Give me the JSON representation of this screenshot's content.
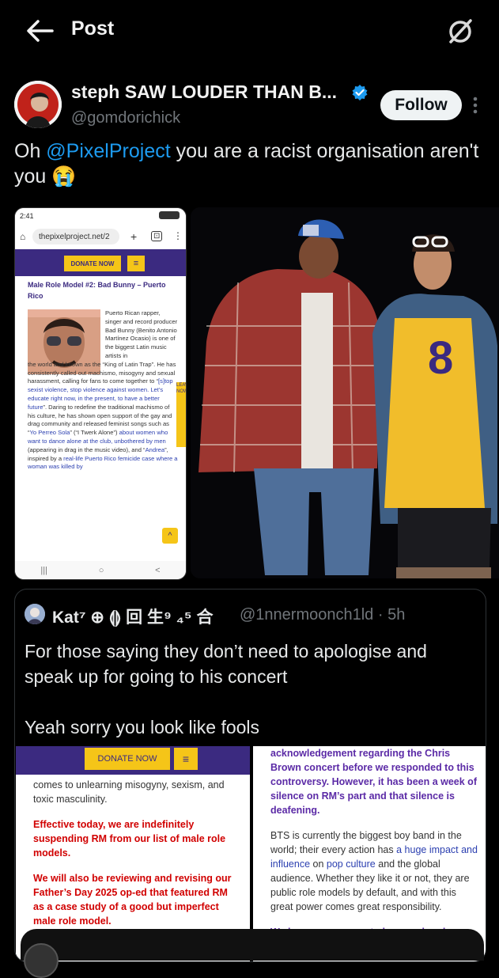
{
  "header": {
    "title": "Post"
  },
  "author": {
    "name": "steph SAW LOUDER THAN B...",
    "handle": "@gomdorichick",
    "follow_label": "Follow"
  },
  "tweet": {
    "text_before": "Oh ",
    "mention": "@PixelProject",
    "text_after": " you are a racist organisation aren't you 😭"
  },
  "media1": {
    "status_time": "2:41",
    "url": "thepixelproject.net/2",
    "donate": "DONATE NOW",
    "menu": "≡",
    "heading": "Male Role Model #2: Bad Bunny – Puerto Rico",
    "body_right": "Puerto Rican rapper, singer and record producer Bad Bunny (Benito Antonio Martínez Ocasio) is one of the biggest Latin music artists in",
    "body_full": "the world and known as the “King of Latin Trap”. He has consistently called out machismo, misogyny and sexual harassment, calling for fans to come together to “",
    "body_link1": "[s]top sexist violence, stop violence against women. Let’s educate right now, in the present, to have a better future",
    "body_mid": "”. Daring to redefine the traditional machismo of his culture, he has shown open support of the gay and drag community and released feminist songs such as “",
    "body_link2": "Yo Perreo Sola",
    "body_mid2": "” (“I Twerk Alone”) ",
    "body_link3": "about women who want to dance alone at the club, unbothered by men",
    "body_mid3": " (appearing in drag in the music video), and “",
    "body_link4": "Andrea",
    "body_mid4": "”, inspired by a ",
    "body_link5": "real-life Puerto Rico femicide case where a woman was killed by",
    "leave_now": "LEAVE NOW"
  },
  "quote": {
    "name": "Kat⁷ ⊕ ⟬⟭ 回 生⁹ ₄⁵ 合",
    "handle": "@1nnermoonch1ld · 5h",
    "text": "For those saying they don’t need to apologise and speak up for going to his concert\n\nYeah sorry you look like fools",
    "img1": {
      "donate": "DONATE NOW",
      "menu": "≡",
      "line1": "comes to unlearning misogyny, sexism, and toxic masculinity.",
      "red1": "Effective today, we are indefinitely suspending RM from our list of male role models.",
      "red2": "We will also be reviewing and revising our Father’s Day 2025 op-ed that featured RM as a case study of a good but imperfect male role model."
    },
    "img2": {
      "purple1": "acknowledgement regarding the Chris Brown concert before we responded to this controversy. However, it has been a week of silence on RM’s part and that silence is deafening.",
      "p2a": "BTS is currently the biggest boy band in the world; their every action has ",
      "link1": "a huge impact and influence",
      "p2b": " on ",
      "link2": "pop culture",
      "p2c": " and the global audience. Whether they like it or not, they are public role models by default, and with this great power comes great responsibility.",
      "purple2": "We have never expected any male role"
    }
  },
  "colors": {
    "accent": "#1d9bf0",
    "follow_bg": "#eff3f4",
    "pixel_purple": "#3b2a80",
    "pixel_yellow": "#f5c518"
  }
}
